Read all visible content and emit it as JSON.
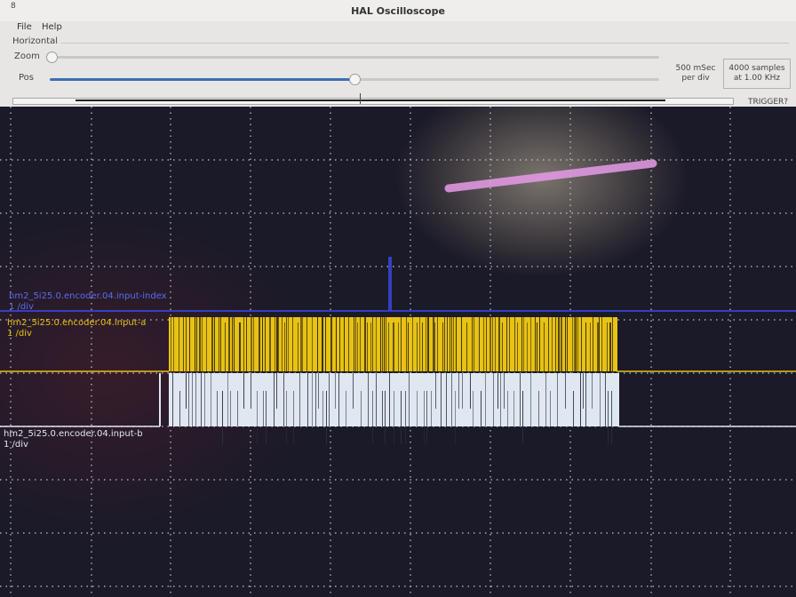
{
  "window": {
    "title": "HAL Oscilloscope",
    "icon": "8"
  },
  "menu": {
    "items": [
      "File",
      "Help"
    ]
  },
  "horizontal": {
    "frame_label": "Horizontal",
    "zoom_label": "Zoom",
    "pos_label": "Pos",
    "zoom_value": 0.0,
    "pos_value": 0.5,
    "rate": "500 mSec",
    "rate_unit": "per div",
    "samples": "4000 samples",
    "samples_rate": "at 1.00 KHz"
  },
  "trigger": {
    "label": "TRIGGER?"
  },
  "traces": [
    {
      "name": "hm2_5i25.0.encoder.04.input-index",
      "scale": "1 /div",
      "color": "#3b4df0"
    },
    {
      "name": "hm2_5i25.0.encoder.04.input-a",
      "scale": "1 /div",
      "color": "#e8c214"
    },
    {
      "name": "hm2_5i25.0.encoder.04.input-b",
      "scale": "1 /div",
      "color": "#dfe8f0"
    }
  ],
  "colors": {
    "grid": "#d8d8d8",
    "screen_bg": "#1b1a28",
    "slider_fill": "#3d6fb3"
  }
}
